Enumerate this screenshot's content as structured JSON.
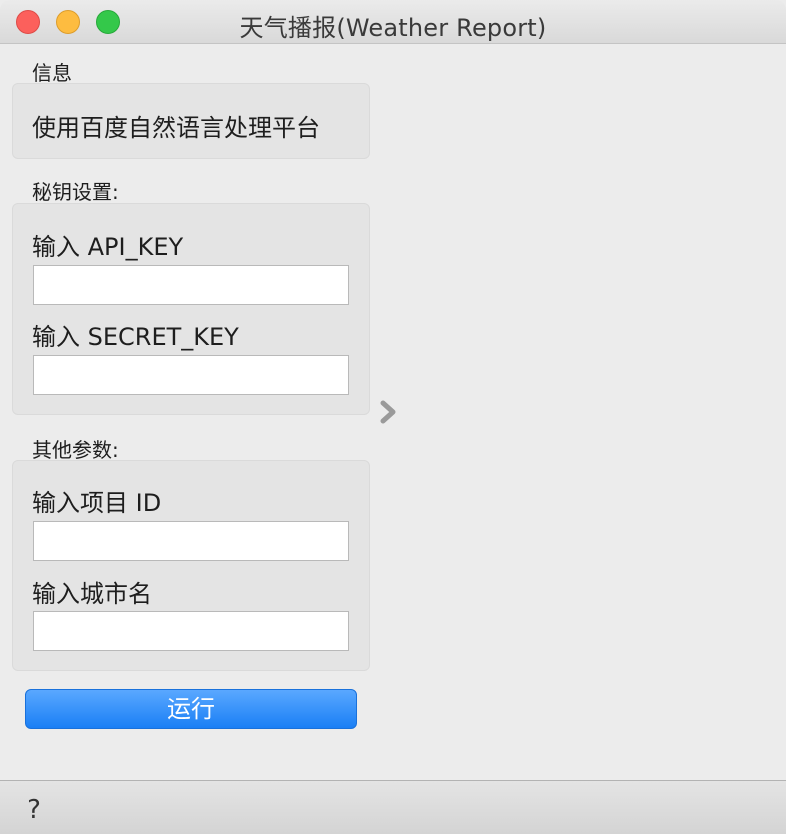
{
  "window": {
    "title": "天气播报(Weather Report)"
  },
  "info": {
    "section_label": "信息",
    "text": "使用百度自然语言处理平台"
  },
  "keys": {
    "section_label": "秘钥设置:",
    "api_key_label": "输入 API_KEY",
    "api_key_value": "",
    "secret_key_label": "输入 SECRET_KEY",
    "secret_key_value": ""
  },
  "params": {
    "section_label": "其他参数:",
    "project_id_label": "输入项目 ID",
    "project_id_value": "",
    "city_label": "输入城市名",
    "city_value": ""
  },
  "actions": {
    "run_label": "运行"
  },
  "statusbar": {
    "help_icon": "question-mark-icon",
    "help_glyph": "?"
  },
  "colors": {
    "close": "#fc605c",
    "minimize": "#fdbc40",
    "maximize": "#34c84a",
    "run_button": "#1a7ff5"
  }
}
